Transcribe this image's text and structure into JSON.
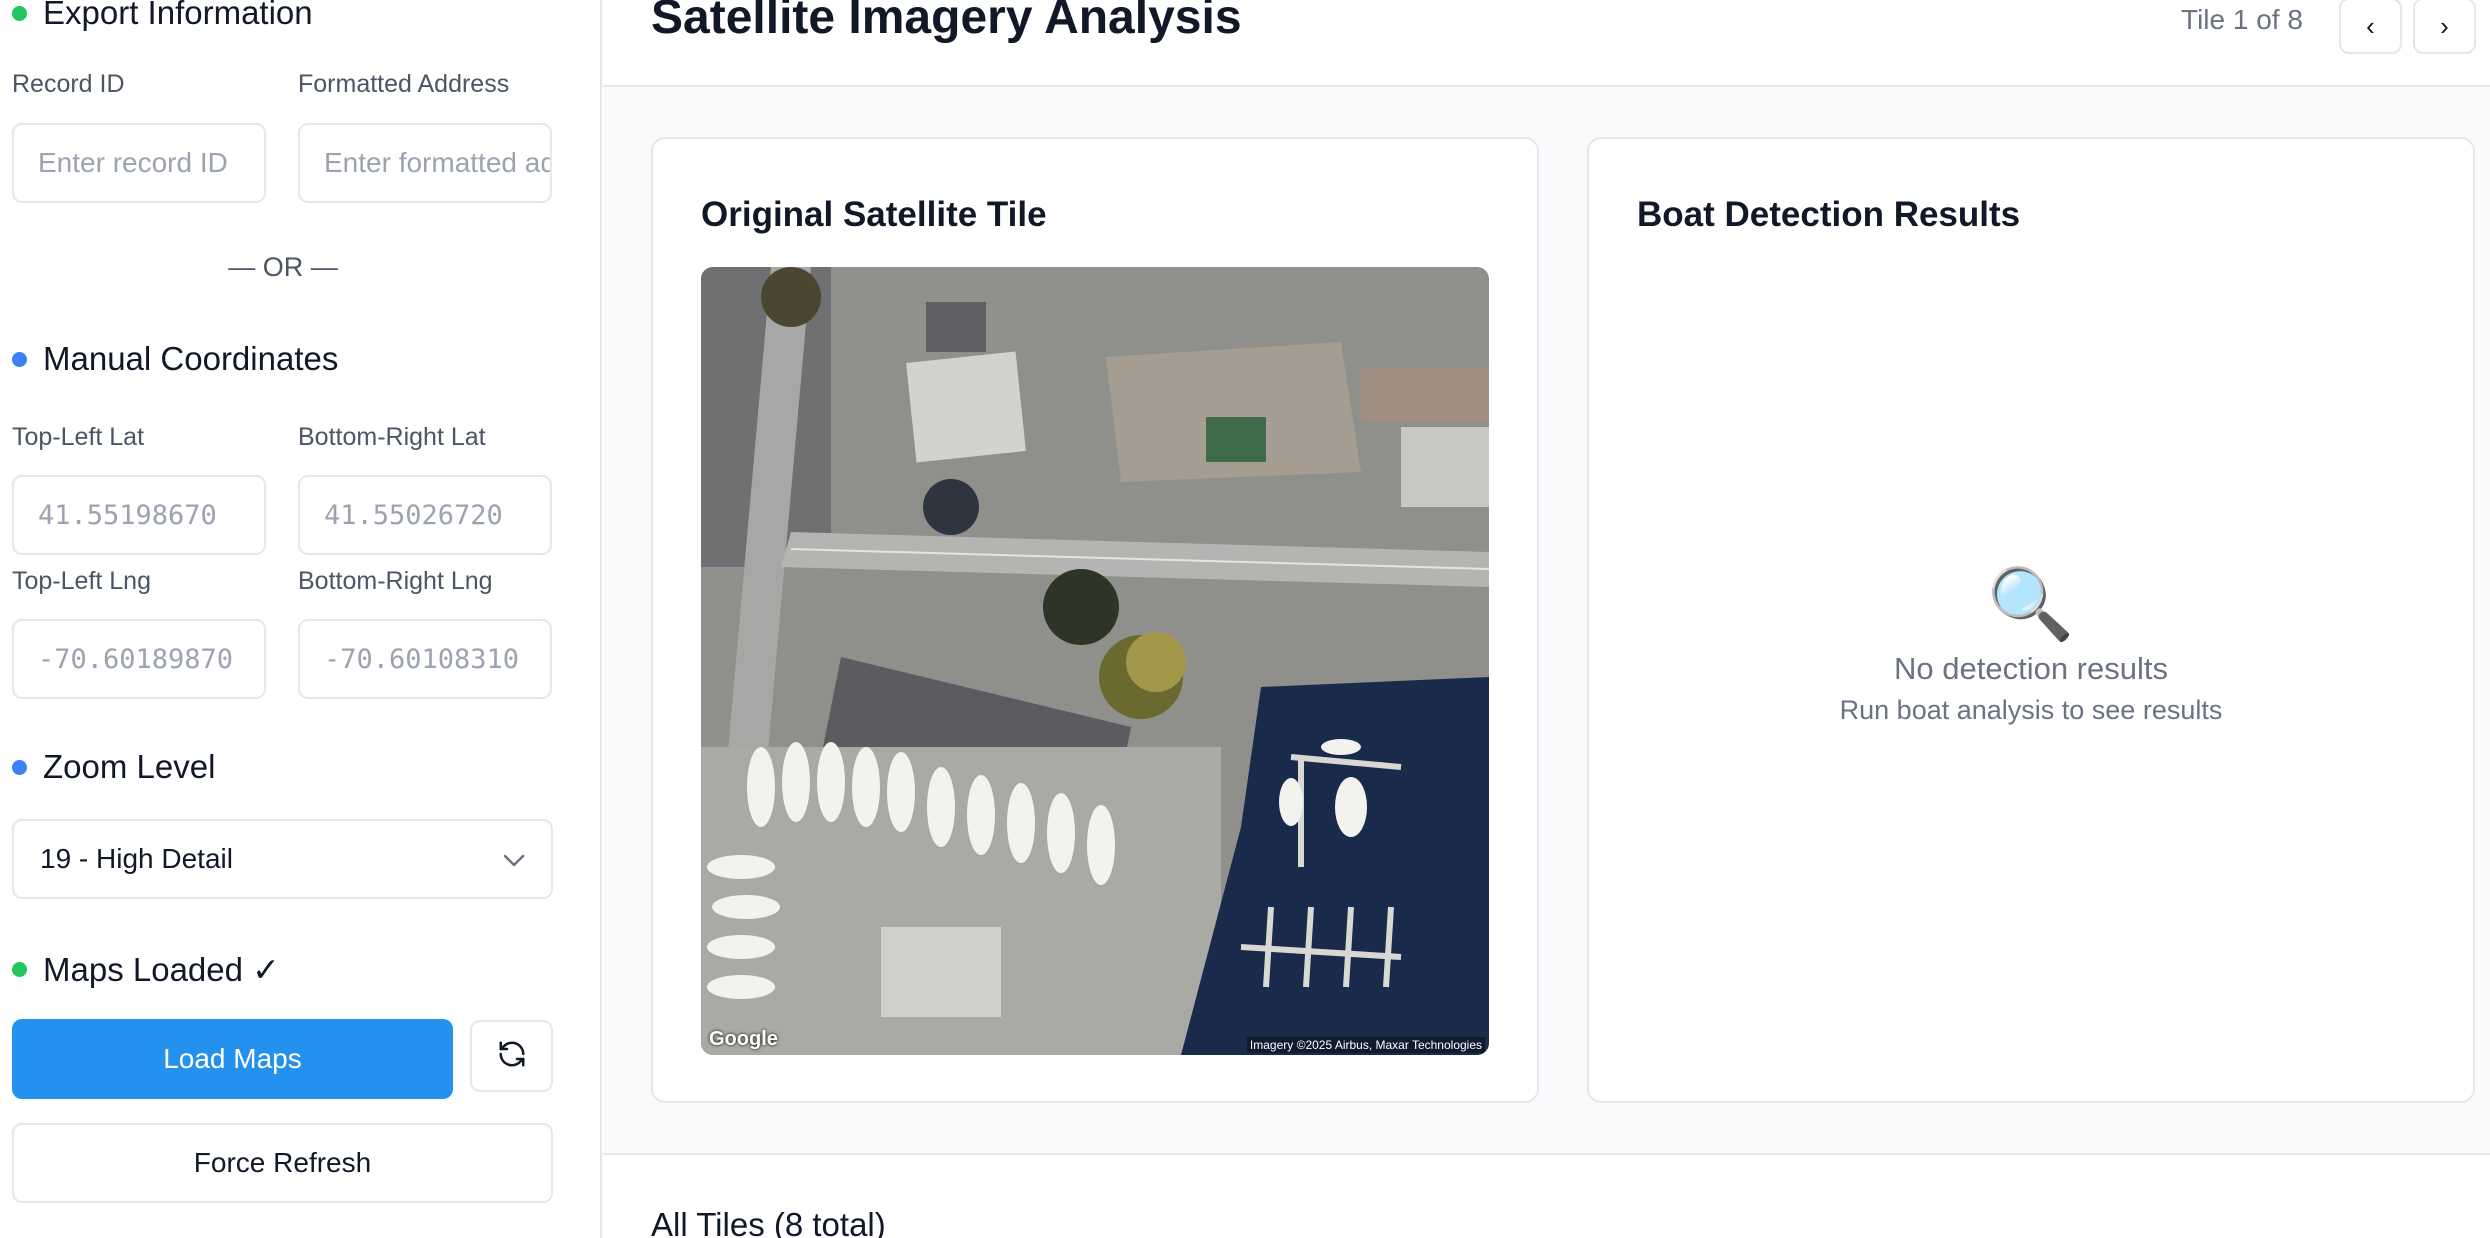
{
  "sidebar": {
    "export_section": {
      "title": "Export Information",
      "status_color": "#22c55e"
    },
    "record_id": {
      "label": "Record ID",
      "placeholder": "Enter record ID"
    },
    "formatted_address": {
      "label": "Formatted Address",
      "placeholder": "Enter formatted address"
    },
    "or_separator": "— OR —",
    "manual_section": {
      "title": "Manual Coordinates",
      "status_color": "#3b82f6"
    },
    "top_left_lat": {
      "label": "Top-Left Lat",
      "value": "41.55198670"
    },
    "bottom_right_lat": {
      "label": "Bottom-Right Lat",
      "value": "41.55026720"
    },
    "top_left_lng": {
      "label": "Top-Left Lng",
      "value": "-70.60189870"
    },
    "bottom_right_lng": {
      "label": "Bottom-Right Lng",
      "value": "-70.60108310"
    },
    "zoom_section": {
      "title": "Zoom Level",
      "status_color": "#3b82f6"
    },
    "zoom_select": {
      "selected": "19 - High Detail"
    },
    "maps_status": {
      "title": "Maps Loaded ✓",
      "status_color": "#22c55e"
    },
    "load_maps_button": "Load Maps",
    "force_refresh_button": "Force Refresh"
  },
  "header": {
    "title": "Satellite Imagery Analysis",
    "tile_counter": "Tile 1 of 8",
    "prev_label": "‹",
    "next_label": "›"
  },
  "original_tile": {
    "title": "Original Satellite Tile",
    "watermark": "Google",
    "attribution": "Imagery ©2025 Airbus, Maxar Technologies"
  },
  "detection": {
    "title": "Boat Detection Results",
    "empty_icon": "🔍",
    "empty_title": "No detection results",
    "empty_subtitle": "Run boat analysis to see results"
  },
  "all_tiles": {
    "title": "All Tiles (8 total)"
  },
  "colors": {
    "primary": "#2591ef",
    "border": "#e5e7eb",
    "muted": "#6b7280"
  }
}
